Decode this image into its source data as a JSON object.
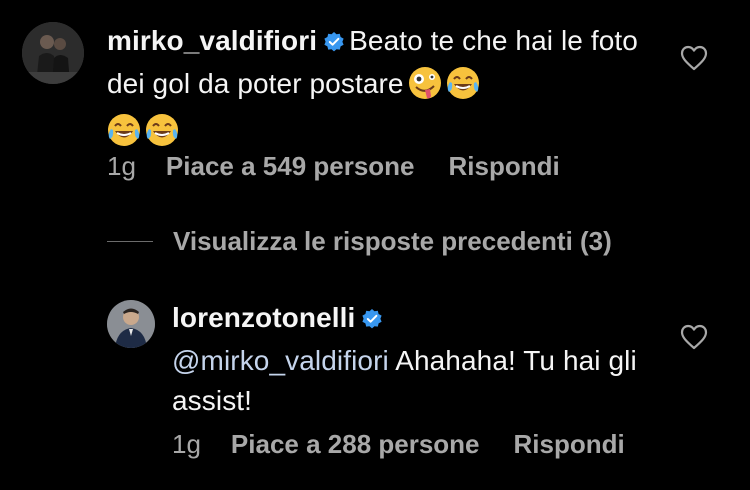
{
  "comments": [
    {
      "username": "mirko_valdifiori",
      "text": "Beato te che hai le foto dei gol da poter postare",
      "emojis": [
        "zany-face-emoji",
        "face-with-tears-of-joy-emoji",
        "face-with-tears-of-joy-emoji",
        "face-with-tears-of-joy-emoji"
      ],
      "time": "1g",
      "likes": "Piace a 549 persone",
      "reply": "Rispondi"
    },
    {
      "username": "lorenzotonelli",
      "mention": "@mirko_valdifiori",
      "text": "Ahahaha! Tu hai gli assist!",
      "time": "1g",
      "likes": "Piace a 288 persone",
      "reply": "Rispondi"
    }
  ],
  "view_replies": "Visualizza le risposte precedenti (3)",
  "colors": {
    "background": "#000000",
    "text": "#f5f5f5",
    "secondary": "#a8a8a8",
    "verified": "#3897f0",
    "mention": "#c5d4ec"
  }
}
